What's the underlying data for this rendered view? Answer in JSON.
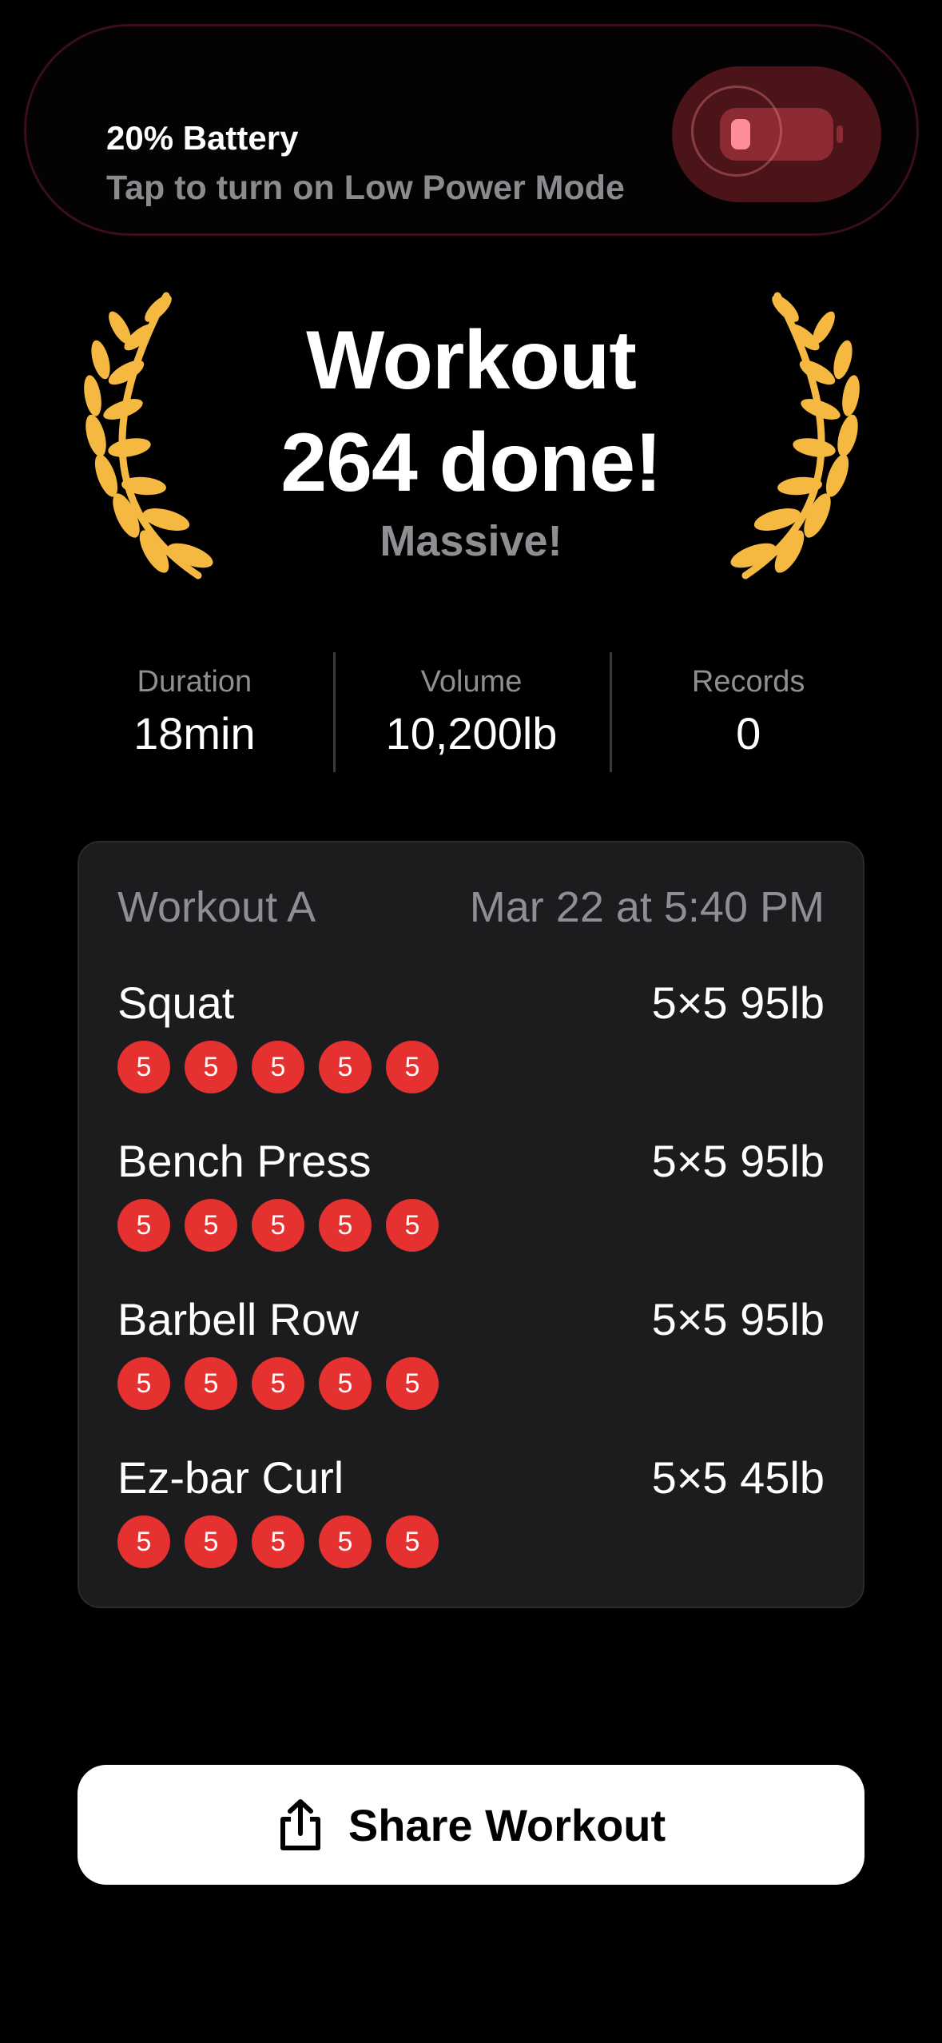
{
  "battery_banner": {
    "title": "20% Battery",
    "subtitle": "Tap to turn on Low Power Mode",
    "level_percent": 20,
    "icon": "low-battery-icon"
  },
  "hero": {
    "line1": "Workout",
    "line2": "264 done!",
    "tagline": "Massive!",
    "laurel_color": "#f5b942"
  },
  "stats": [
    {
      "label": "Duration",
      "value": "18min"
    },
    {
      "label": "Volume",
      "value": "10,200lb"
    },
    {
      "label": "Records",
      "value": "0"
    }
  ],
  "card": {
    "workout_name": "Workout A",
    "date": "Mar 22 at 5:40 PM",
    "exercises": [
      {
        "name": "Squat",
        "scheme": "5×5 95lb",
        "sets": [
          "5",
          "5",
          "5",
          "5",
          "5"
        ]
      },
      {
        "name": "Bench Press",
        "scheme": "5×5 95lb",
        "sets": [
          "5",
          "5",
          "5",
          "5",
          "5"
        ]
      },
      {
        "name": "Barbell Row",
        "scheme": "5×5 95lb",
        "sets": [
          "5",
          "5",
          "5",
          "5",
          "5"
        ]
      },
      {
        "name": "Ez-bar Curl",
        "scheme": "5×5 45lb",
        "sets": [
          "5",
          "5",
          "5",
          "5",
          "5"
        ]
      }
    ],
    "set_color": "#e53130"
  },
  "share_button": {
    "label": "Share Workout",
    "icon": "share-icon"
  }
}
